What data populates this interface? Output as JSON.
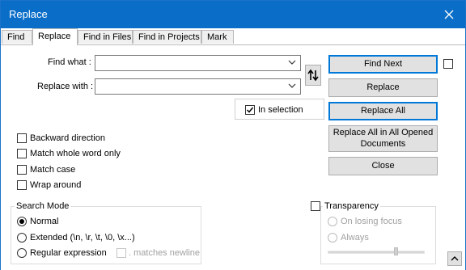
{
  "window": {
    "title": "Replace",
    "close_icon": "close-icon"
  },
  "tabs": [
    {
      "label": "Find"
    },
    {
      "label": "Replace"
    },
    {
      "label": "Find in Files"
    },
    {
      "label": "Find in Projects"
    },
    {
      "label": "Mark"
    }
  ],
  "active_tab": "Replace",
  "form": {
    "find_what_label": "Find what :",
    "find_what_value": "",
    "replace_with_label": "Replace with :",
    "replace_with_value": "",
    "in_selection_label": "In selection",
    "in_selection_checked": true
  },
  "buttons": {
    "find_next": "Find Next",
    "replace": "Replace",
    "replace_all": "Replace All",
    "replace_all_opened": "Replace All in All Opened Documents",
    "close": "Close"
  },
  "options": [
    {
      "label": "Backward direction",
      "checked": false
    },
    {
      "label": "Match whole word only",
      "checked": false
    },
    {
      "label": "Match case",
      "checked": false
    },
    {
      "label": "Wrap around",
      "checked": false
    }
  ],
  "search_mode": {
    "title": "Search Mode",
    "modes": [
      {
        "label": "Normal",
        "selected": true
      },
      {
        "label": "Extended (\\n, \\r, \\t, \\0, \\x...)",
        "selected": false
      },
      {
        "label": "Regular expression",
        "selected": false
      }
    ],
    "matches_newline_label": ". matches newline"
  },
  "transparency": {
    "label": "Transparency",
    "checked": false,
    "on_losing_focus": "On losing focus",
    "always": "Always"
  },
  "colors": {
    "titlebar": "#0a6dc7",
    "focus_border": "#0078d7"
  }
}
